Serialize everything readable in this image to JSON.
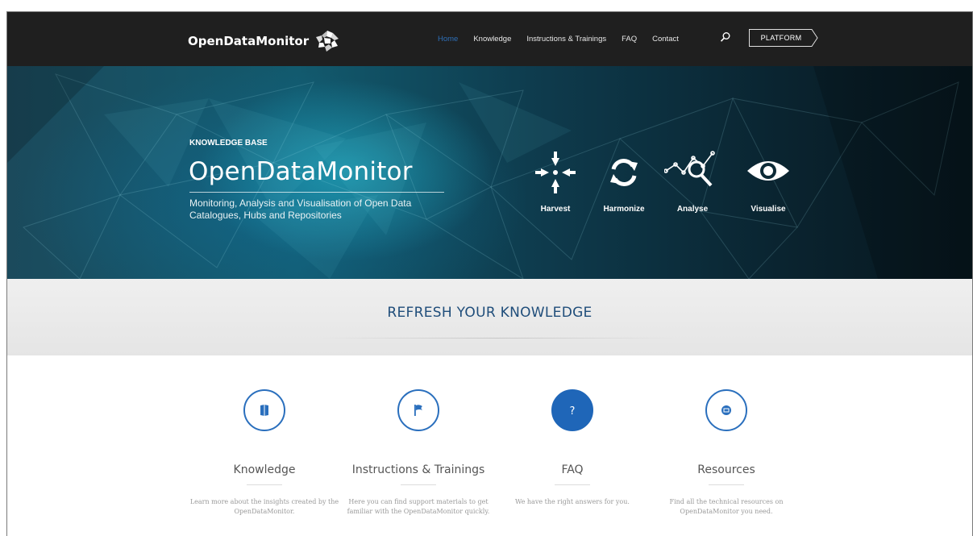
{
  "navbar": {
    "logo_text": "OpenDataMonitor",
    "links": [
      {
        "label": "Home",
        "active": true
      },
      {
        "label": "Knowledge",
        "active": false
      },
      {
        "label": "Instructions & Trainings",
        "active": false
      },
      {
        "label": "FAQ",
        "active": false
      },
      {
        "label": "Contact",
        "active": false
      }
    ],
    "search_icon": "search-icon",
    "platform_label": "PLATFORM"
  },
  "hero": {
    "kicker": "KNOWLEDGE BASE",
    "title": "OpenDataMonitor",
    "subtitle": "Monitoring, Analysis and Visualisation of Open Data Catalogues, Hubs and Repositories",
    "features": [
      {
        "label": "Harvest",
        "icon": "harvest-icon"
      },
      {
        "label": "Harmonize",
        "icon": "harmonize-icon"
      },
      {
        "label": "Analyse",
        "icon": "analyse-icon"
      },
      {
        "label": "Visualise",
        "icon": "visualise-icon"
      }
    ]
  },
  "section": {
    "title": "REFRESH YOUR KNOWLEDGE"
  },
  "cards": [
    {
      "title": "Knowledge",
      "icon": "book-icon",
      "description": "Learn more about the insights created by the OpenDataMonitor."
    },
    {
      "title": "Instructions & Trainings",
      "icon": "flag-icon",
      "description": "Here you can find support materials to get familiar with the OpenDataMonitor quickly."
    },
    {
      "title": "FAQ",
      "icon": "question-icon",
      "description": "We have the right answers for you."
    },
    {
      "title": "Resources",
      "icon": "resources-icon",
      "description": "Find all the technical resources on OpenDataMonitor you need."
    }
  ],
  "colors": {
    "navbar_bg": "#1f1f1f",
    "accent_blue": "#1f66b8",
    "nav_active": "#2e6fb7",
    "section_title": "#1f4d7a"
  }
}
